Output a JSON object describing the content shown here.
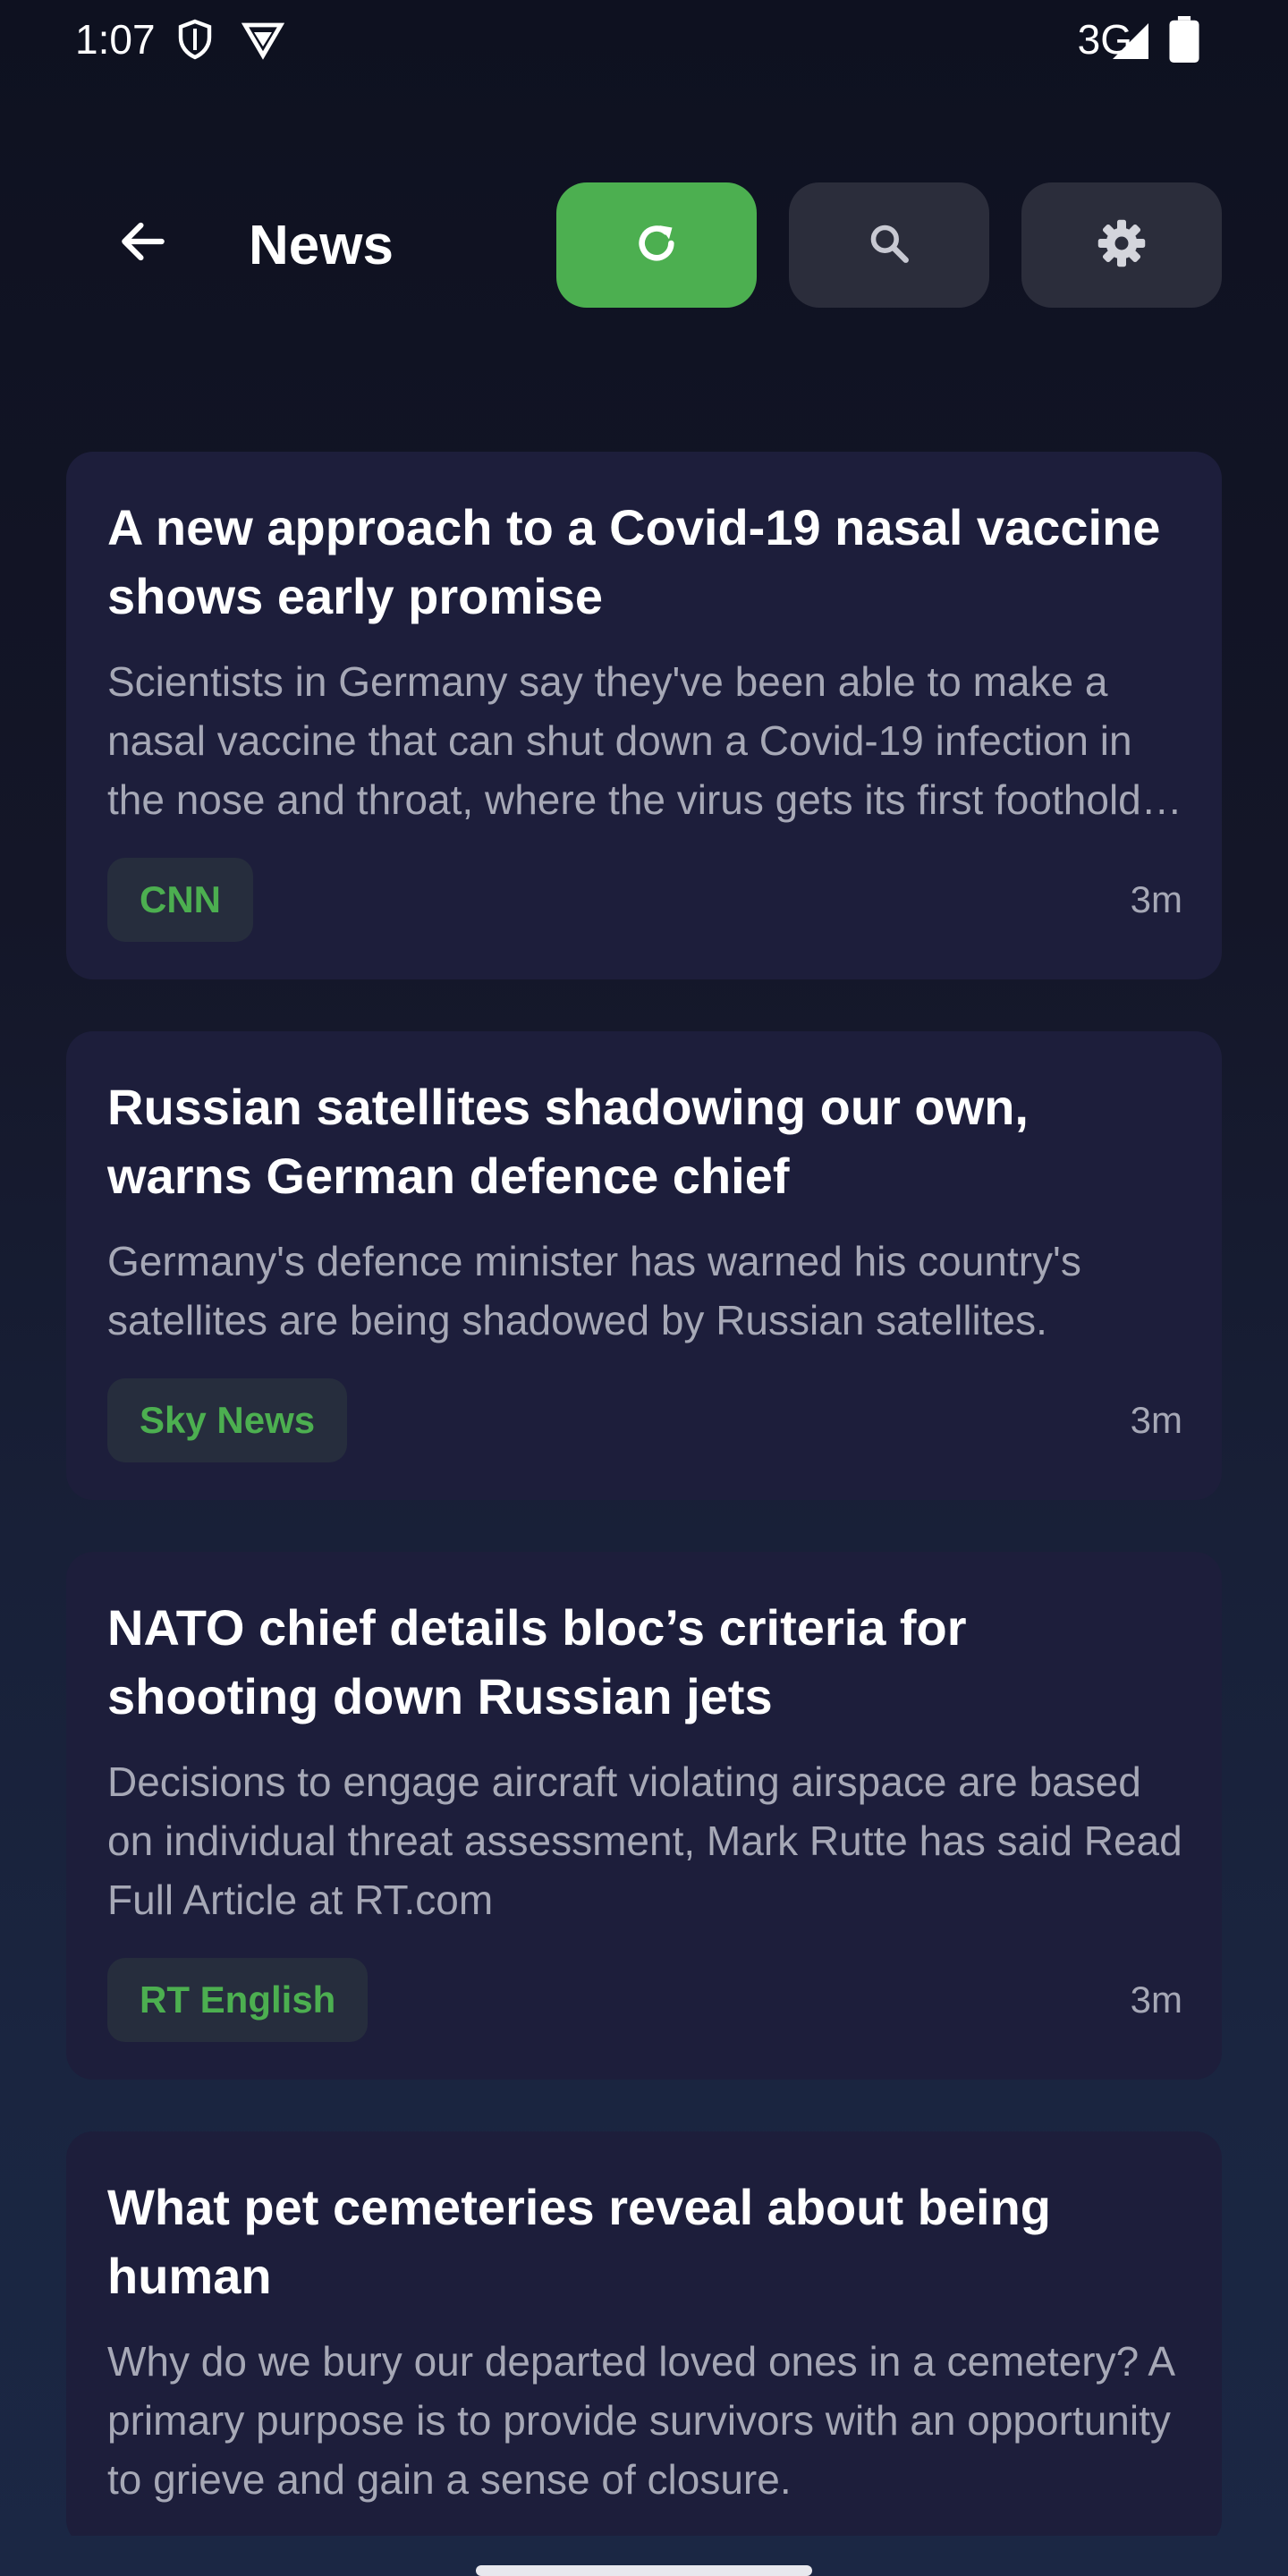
{
  "status_bar": {
    "time": "1:07",
    "network": "3G",
    "icons": [
      "shield-icon",
      "vpn-icon",
      "signal-icon",
      "battery-icon"
    ]
  },
  "header": {
    "title": "News",
    "back_icon": "arrow-back-icon",
    "buttons": [
      {
        "name": "refresh",
        "icon": "refresh-icon",
        "active": true
      },
      {
        "name": "search",
        "icon": "search-icon",
        "active": false
      },
      {
        "name": "settings",
        "icon": "gear-icon",
        "active": false
      }
    ]
  },
  "colors": {
    "accent": "#4caf50",
    "card_bg": "#1d1e3b",
    "button_bg": "#2b2d3b",
    "badge_bg": "#262d3d",
    "secondary_text": "#a6a8b6"
  },
  "articles": [
    {
      "title": "A new approach to a Covid-19 nasal vaccine shows early promise",
      "summary": "Scientists in Germany say they've been able to make a nasal vaccine that can shut down a Covid-19 infection in the nose and throat, where the virus gets its first foothold in the body.",
      "source": "CNN",
      "time": "3m"
    },
    {
      "title": "Russian satellites shadowing our own, warns German defence chief",
      "summary": "Germany's defence minister has warned his country's satellites are being shadowed by Russian satellites.",
      "source": "Sky News",
      "time": "3m"
    },
    {
      "title": "NATO chief details bloc’s criteria for shooting down Russian jets",
      "summary": "Decisions to engage aircraft violating airspace are based on individual threat assessment, Mark Rutte has said Read Full Article at RT.com",
      "source": "RT English",
      "time": "3m"
    },
    {
      "title": "What pet cemeteries reveal about being human",
      "summary": "Why do we bury our departed loved ones in a cemetery? A primary purpose is to provide survivors with an opportunity to grieve and gain a sense of closure.",
      "source": "",
      "time": ""
    }
  ]
}
